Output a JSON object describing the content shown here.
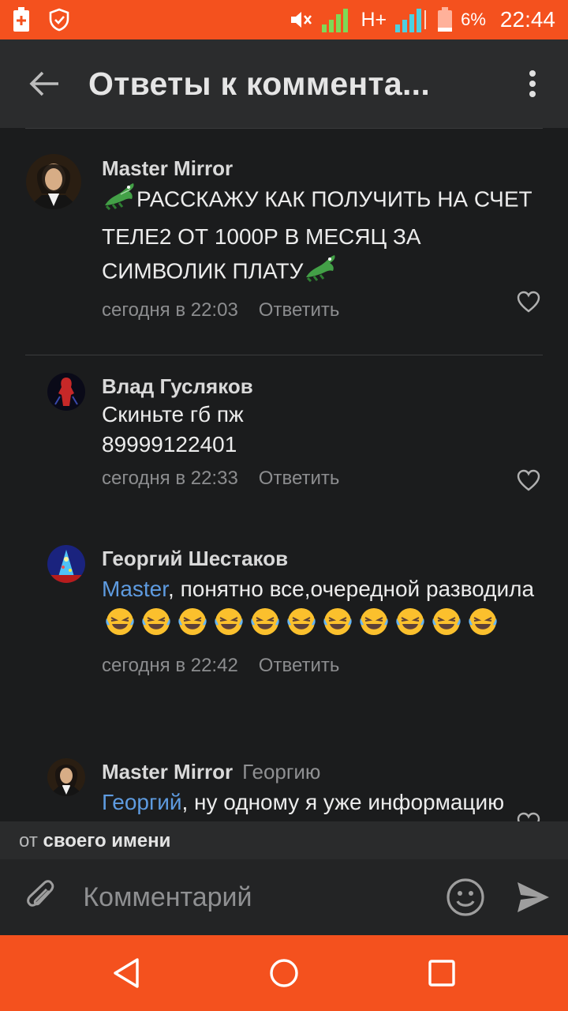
{
  "status_bar": {
    "battery_percent": "6%",
    "time": "22:44",
    "network_type": "H+",
    "icons": [
      "battery-saver-icon",
      "shield-icon",
      "mute-icon",
      "signal-icon",
      "battery-icon"
    ]
  },
  "app_bar": {
    "title": "Ответы к коммента..."
  },
  "comments": [
    {
      "author": "Master Mirror",
      "text": "РАССКАЖУ КАК ПОЛУЧИТЬ НА СЧЕТ ТЕЛЕ2 ОТ 1000Р В МЕСЯЦ ЗА СИМВОЛИК ПЛАТУ",
      "time": "сегодня в 22:03",
      "reply_label": "Ответить"
    },
    {
      "author": "Влад Гусляков",
      "text_line1": "Скиньте гб пж",
      "text_line2": "89999122401",
      "time": "сегодня в 22:33",
      "reply_label": "Ответить"
    },
    {
      "author": "Георгий Шестаков",
      "mention": "Master",
      "text": ", понятно все,очередной разводила",
      "emoji_count": 11,
      "time": "сегодня в 22:42",
      "reply_label": "Ответить"
    },
    {
      "author": "Master Mirror",
      "reply_to": "Георгию",
      "mention": "Георгий",
      "text": ", ну одному я уже информацию"
    }
  ],
  "from_bar": {
    "prefix": "от",
    "value": "своего имени"
  },
  "input": {
    "placeholder": "Комментарий"
  },
  "colors": {
    "accent": "#f4511e",
    "background": "#1b1c1d",
    "mention": "#5e9be0"
  }
}
